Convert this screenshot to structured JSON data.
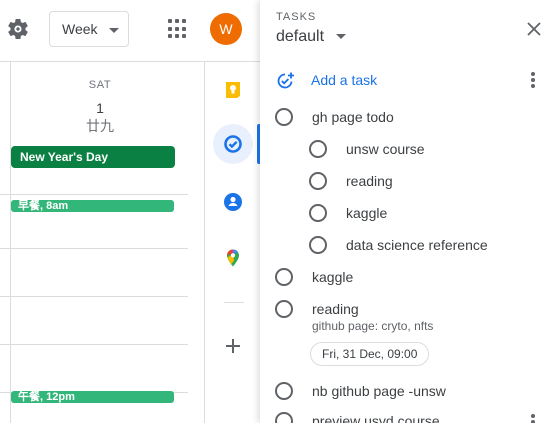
{
  "calendar": {
    "view_label": "Week",
    "avatar_initial": "W",
    "day": {
      "name": "SAT",
      "number": "1",
      "lunar": "廿九"
    },
    "allday_event": "New Year's Day",
    "events": [
      {
        "label": "早餐, 8am"
      },
      {
        "label": "午餐, 12pm"
      }
    ]
  },
  "rail": {
    "items": [
      {
        "name": "keep",
        "icon": "keep-icon",
        "color": "#fbbc04"
      },
      {
        "name": "tasks",
        "icon": "tasks-icon",
        "color": "#1a73e8",
        "active": true
      },
      {
        "name": "contacts",
        "icon": "contacts-icon",
        "color": "#1a73e8"
      },
      {
        "name": "maps",
        "icon": "maps-icon",
        "color": "#34a853"
      }
    ],
    "add_icon": "plus-icon"
  },
  "tasks_panel": {
    "header": "TASKS",
    "list_name": "default",
    "add_label": "Add a task",
    "tasks": [
      {
        "title": "gh page todo",
        "level": 0
      },
      {
        "title": "unsw course",
        "level": 1
      },
      {
        "title": "reading",
        "level": 1
      },
      {
        "title": "kaggle",
        "level": 1
      },
      {
        "title": "data science reference",
        "level": 1
      },
      {
        "title": "kaggle",
        "level": 0
      },
      {
        "title": "reading",
        "level": 0,
        "notes": "github page: cryto, nfts",
        "due": "Fri, 31 Dec, 09:00"
      },
      {
        "title": "nb github page -unsw",
        "level": 0
      },
      {
        "title": "preview usyd course",
        "level": 0
      }
    ]
  },
  "colors": {
    "accent": "#1a73e8",
    "holiday": "#0b8043",
    "event": "#33b679",
    "avatar": "#ef6c00"
  }
}
